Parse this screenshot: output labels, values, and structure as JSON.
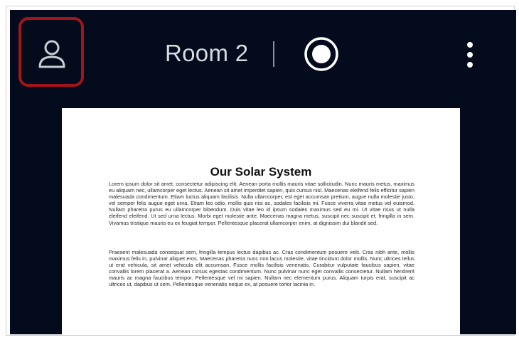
{
  "header": {
    "room_title": "Room 2",
    "icons": [
      "person-icon",
      "record-icon",
      "more-vertical-icon"
    ],
    "highlight_color": "#a3141b"
  },
  "document": {
    "title": "Our Solar System",
    "paragraphs": [
      "Lorem ipsum dolor sit amet, consectetur adipiscing elit. Aenean porta mollis mauris vitae sollicitudin. Nunc mauris metus, maximus eu aliquam nec, ullamcorper eget lectus. Aenean sit amet imperdiet sapien, quis cursus nisl. Maecenas eleifend felis efficitur sapien malesuada condimentum. Etiam luctus aliquam facilisis. Nulla ullamcorper, est eget accumsan pretium, augue nulla molestie justo, vel semper felis augue eget urna. Etiam leo odio, mollis quis nisi ac, sodales facilisis mi. Fusce viverra vitae metus vel euismod. Nullam pharetra purus eu ullamcorper bibendum. Duis vitae leo id ipsum sodales maximus sed eu mi. Ut vitae risus ut nulla eleifend eleifend. Ut sed urna lectus. Morbi eget molestie ante. Maecenas magna metus, suscipit nec suscipit et, fringilla in sem. Vivamus tristique mauris eu ex feugiat tempor. Pellentesque placerat ullamcorper enim, at dignissim dui blandit sed.",
      "Praesent malesuada consequat sem, fringilla tempus lectus dapibus ac. Cras condimentum posuere velit. Cras nibh ante, mollis maximus felis in, pulvinar aliquet eros. Maecenas pharetra nunc non lacus molestie, vitae tincidunt dolor mollis. Nunc ultrices tellus ut erat vehicula, sit amet vehicula elit accumsan. Fusce mollis facilisis venenatis. Curabitur vulputate faucibus sapien, vitae convallis lorem placerat a. Aenean cursus egestas condimentum. Nunc pulvinar nunc eget convallis consectetur. Nullam hendrerit mauris ac magna faucibus tempor. Pellentesque vel mi sapien. Nullam nec elementum purus. Aliquam turpis erat, suscipit ac ultrices ut, dapibus ut sem. Pellentesque venenatis neque ex, at posuere tortor lacinia in."
    ]
  }
}
